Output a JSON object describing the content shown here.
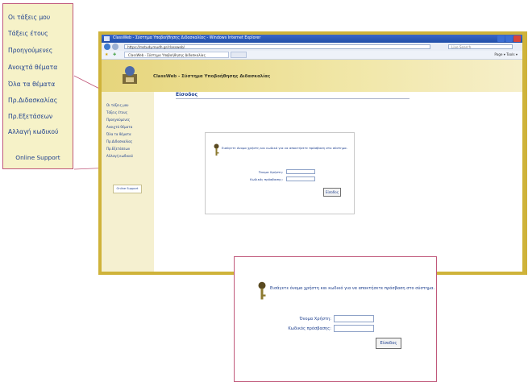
{
  "callout_menu": {
    "items": [
      "Οι τάξεις μου",
      "Τάξεις έτους",
      "Προηγούμενες",
      "Ανοιχτά θέματα",
      "Όλα τα θέματα",
      "Πρ.Διδασκαλίας",
      "Πρ.Εξετάσεων",
      "Αλλαγή κωδικού"
    ],
    "support": "Online Support"
  },
  "browser": {
    "title": "ClassWeb - Σύστημα Υποβοήθησης Διδασκαλίας - Windows Internet Explorer",
    "address": "https://mstudy.mudh.gr/classweb/",
    "search_placeholder": "Live Search",
    "tab_label": "ClassWeb - Σύστημα Υποβοήθησης Διδασκαλίας",
    "tools": "Page ▾  Tools ▾"
  },
  "app": {
    "title": "ClassWeb - Σύστημα Υποβοήθησης Διδασκαλίας",
    "sidebar_items": [
      "Οι τάξεις μου",
      "Τάξεις έτους",
      "Προηγούμενες",
      "Ανοιχτά θέματα",
      "Όλα τα θέματα",
      "Πρ.Διδασκαλίας",
      "Πρ.Εξετάσεων",
      "Αλλαγή κωδικού"
    ],
    "support": "Online Support",
    "content_title": "Είσοδος"
  },
  "login": {
    "message": "Εισάγετε όνομα χρήστη και κωδικό για να αποκτήσετε πρόσβαση στο σύστημα.",
    "username_label": "Όνομα Χρήστη:",
    "password_label": "Κωδικός πρόσβασης:",
    "submit_label": "Είσοδος"
  },
  "colors": {
    "frame": "#cfb33a",
    "callout_border": "#c0587a",
    "link": "#1d3f8e"
  }
}
